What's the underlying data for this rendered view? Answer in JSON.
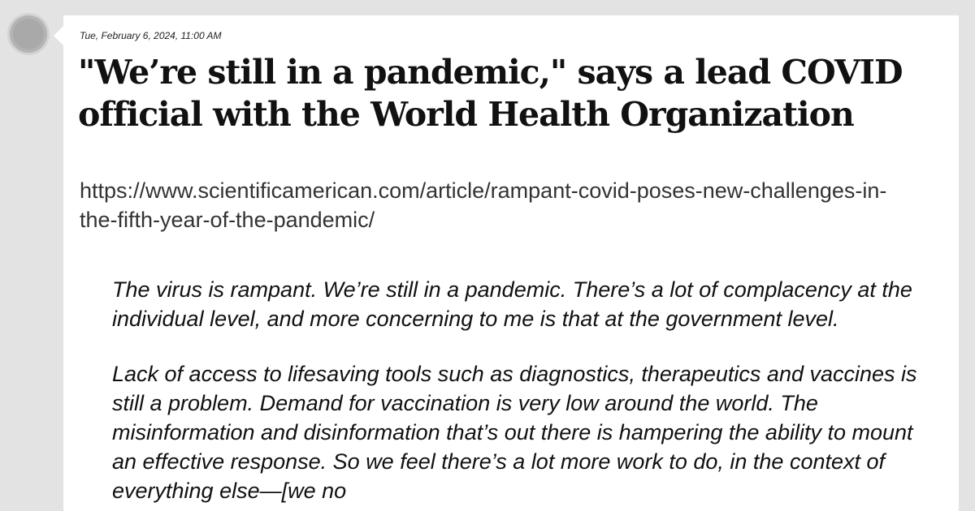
{
  "post": {
    "timestamp": "Tue, February 6, 2024, 11:00 AM",
    "title": "\"We’re still in a pandemic,\" says a lead COVID official with the World Health Organization",
    "link": "https://www.scientificamerican.com/article/rampant-covid-poses-new-challenges-in-the-fifth-year-of-the-pandemic/",
    "quote_paragraphs": [
      "The virus is rampant. We’re still in a pandemic. There’s a lot of complacency at the individual level, and more concerning to me is that at the government level.",
      "Lack of access to lifesaving tools such as diagnostics, therapeutics and vaccines is still a problem. Demand for vaccination is very low around the world. The misinformation and disinformation that’s out there is hampering the ability to mount an effective response. So we feel there’s a lot more work to do, in the context of everything else—[we no"
    ]
  }
}
